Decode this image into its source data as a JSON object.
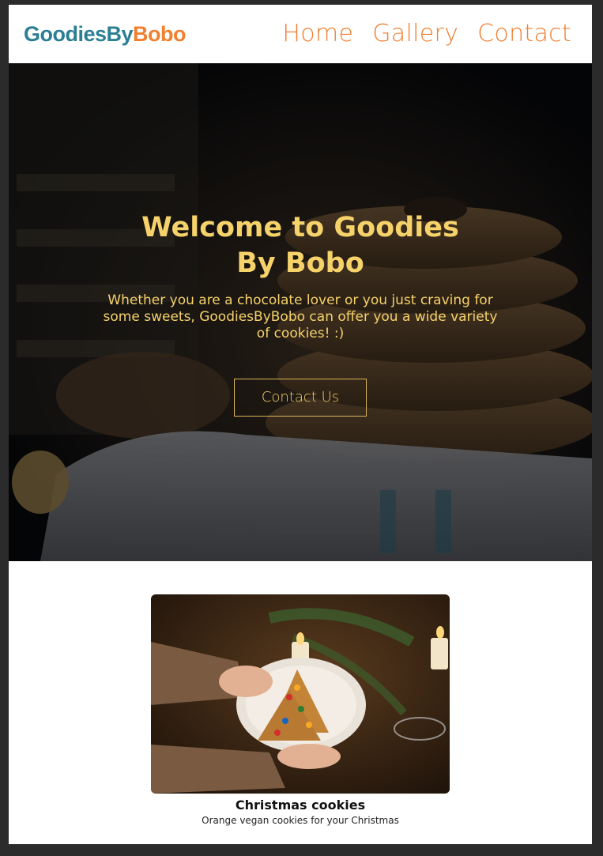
{
  "header": {
    "logo_part1": "GoodiesBy",
    "logo_part2": "Bobo",
    "nav": [
      {
        "label": "Home"
      },
      {
        "label": "Gallery"
      },
      {
        "label": "Contact"
      }
    ]
  },
  "hero": {
    "title": "Welcome to Goodies By Bobo",
    "subtitle": "Whether you are a chocolate lover or you just craving for some sweets, GoodiesByBobo can offer you a wide variety of cookies! :)",
    "cta_label": "Contact Us",
    "image_icon": "cookie-stack-photo"
  },
  "gallery": {
    "items": [
      {
        "title": "Christmas cookies",
        "description": "Orange vegan cookies for your Christmas",
        "image_icon": "christmas-cookies-photo"
      }
    ]
  },
  "colors": {
    "brand_teal": "#2c7f93",
    "brand_orange": "#f08030",
    "hero_text": "#f5d26a"
  }
}
